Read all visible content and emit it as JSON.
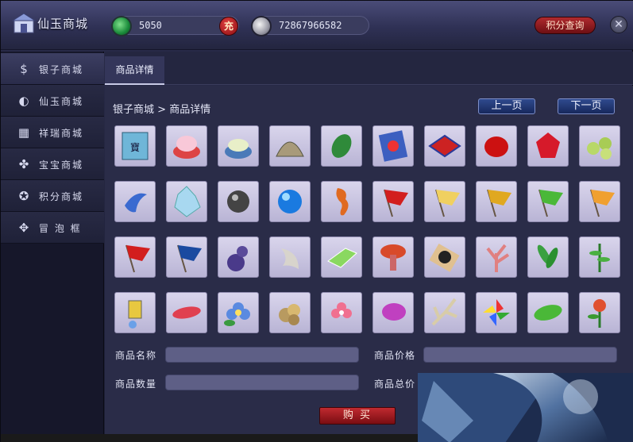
{
  "window": {
    "title": "仙玉商城",
    "jade_balance": "5050",
    "recharge_label": "充",
    "silver_balance": "72867966582",
    "points_query_label": "积分查询",
    "close_label": "✕"
  },
  "sidebar": {
    "items": [
      {
        "label": "银子商城",
        "icon": "money-bag-icon",
        "active": true
      },
      {
        "label": "仙玉商城",
        "icon": "jade-icon",
        "active": false
      },
      {
        "label": "祥瑞商城",
        "icon": "gift-icon",
        "active": false
      },
      {
        "label": "宝宝商城",
        "icon": "paw-icon",
        "active": false
      },
      {
        "label": "积分商城",
        "icon": "star-badge-icon",
        "active": false
      },
      {
        "label": "冒 泡 框",
        "icon": "clover-icon",
        "active": false
      }
    ]
  },
  "tabs": [
    {
      "label": "商品详情"
    }
  ],
  "breadcrumb": {
    "root": "银子商城",
    "sep": ">",
    "current": "商品详情"
  },
  "pager": {
    "prev": "上一页",
    "next": "下一页"
  },
  "items": [
    {
      "name": "book-icon"
    },
    {
      "name": "fire-bowl-icon"
    },
    {
      "name": "rice-bowl-icon"
    },
    {
      "name": "shell-icon"
    },
    {
      "name": "leaf-icon"
    },
    {
      "name": "scroll-icon"
    },
    {
      "name": "carpet-icon"
    },
    {
      "name": "red-stone-icon"
    },
    {
      "name": "ruby-icon"
    },
    {
      "name": "green-pearls-icon"
    },
    {
      "name": "blue-moon-icon"
    },
    {
      "name": "ice-crystal-icon"
    },
    {
      "name": "dark-gem-icon"
    },
    {
      "name": "blue-gem-icon"
    },
    {
      "name": "seahorse-icon"
    },
    {
      "name": "red-flag-icon"
    },
    {
      "name": "yellow-flag-icon"
    },
    {
      "name": "gold-flag-icon"
    },
    {
      "name": "green-flag-icon"
    },
    {
      "name": "orange-flag-icon"
    },
    {
      "name": "red-flag-icon"
    },
    {
      "name": "blue-flag-icon"
    },
    {
      "name": "gourd-icon"
    },
    {
      "name": "white-horn-icon"
    },
    {
      "name": "green-crystal-icon"
    },
    {
      "name": "mushroom-icon"
    },
    {
      "name": "dark-pearl-icon"
    },
    {
      "name": "coral-icon"
    },
    {
      "name": "bamboo-leaf-icon"
    },
    {
      "name": "fern-icon"
    },
    {
      "name": "lantern-icon"
    },
    {
      "name": "feather-icon"
    },
    {
      "name": "blue-flower-icon"
    },
    {
      "name": "ore-icon"
    },
    {
      "name": "pink-flower-icon"
    },
    {
      "name": "purple-seed-icon"
    },
    {
      "name": "antler-icon"
    },
    {
      "name": "pinwheel-icon"
    },
    {
      "name": "green-feather-icon"
    },
    {
      "name": "herb-icon"
    }
  ],
  "form": {
    "name_label": "商品名称",
    "price_label": "商品价格",
    "qty_label": "商品数量",
    "total_label": "商品总价",
    "name_value": "",
    "price_value": "",
    "qty_value": "",
    "total_value": ""
  },
  "buy_label": "购 买",
  "colors": {
    "accent_red": "#a81e24",
    "panel": "#2a2c48",
    "sidebar": "#16172a",
    "nav_button": "#23397a"
  }
}
